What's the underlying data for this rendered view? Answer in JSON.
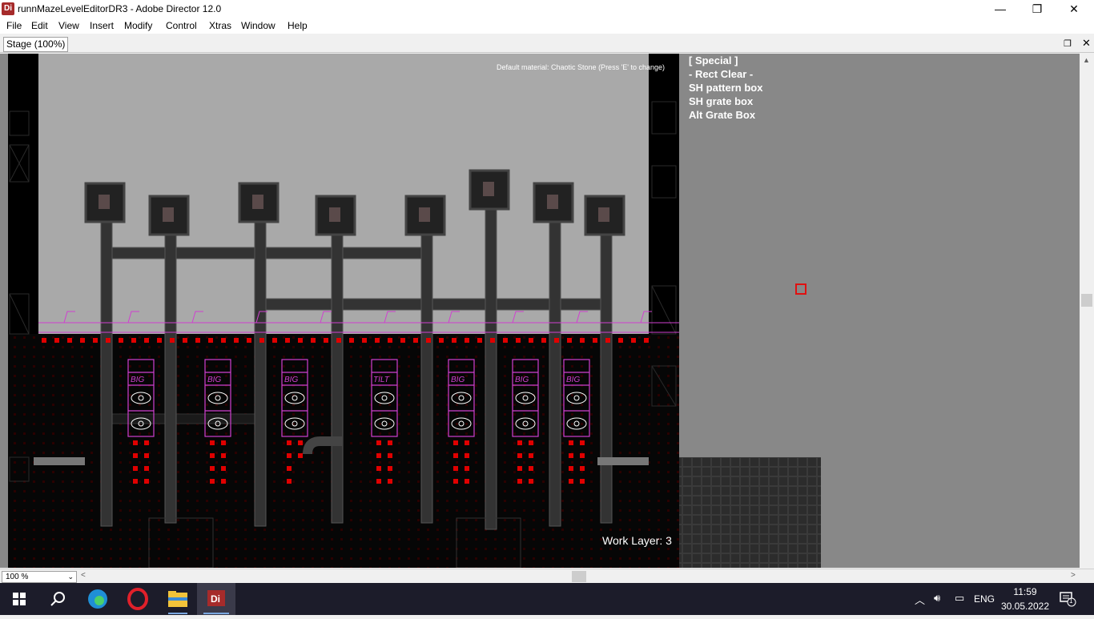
{
  "window": {
    "title": "runnMazeLevelEditorDR3 - Adobe Director 12.0",
    "app_icon_label": "Di",
    "controls": {
      "minimize": "—",
      "restore": "❐",
      "close": "✕"
    }
  },
  "menu": [
    "File",
    "Edit",
    "View",
    "Insert",
    "Modify",
    "Control",
    "Xtras",
    "Window",
    "Help"
  ],
  "stage_panel": {
    "tab_label": "Stage (100%)",
    "restore_glyph": "❐",
    "close_glyph": "✕"
  },
  "editor": {
    "default_material_text": "Default material: Chaotic Stone (Press 'E' to change)",
    "special_list": [
      "[ Special ]",
      "- Rect Clear -",
      "SH pattern box",
      "SH grate box",
      "Alt Grate Box"
    ],
    "work_layer_text": "Work Layer: 3",
    "machine_labels": [
      "BIG",
      "BIG",
      "BIG",
      "TILT",
      "BIG",
      "BIG",
      "BIG"
    ],
    "colors": {
      "background": "#888888",
      "sky": "#a8a8a8",
      "wall": "#000000",
      "accent_magenta": "#d040d0",
      "accent_red": "#e00000"
    }
  },
  "bottom_bar": {
    "zoom_value": "100 %",
    "left_arrow": "<",
    "right_arrow": ">"
  },
  "taskbar": {
    "apps": [
      "start-icon",
      "search-icon",
      "edge-icon",
      "opera-icon",
      "file-explorer-icon",
      "director-icon"
    ],
    "director_label": "Di",
    "language": "ENG",
    "time": "11:59",
    "date": "30.05.2022",
    "notification_count": "1"
  }
}
